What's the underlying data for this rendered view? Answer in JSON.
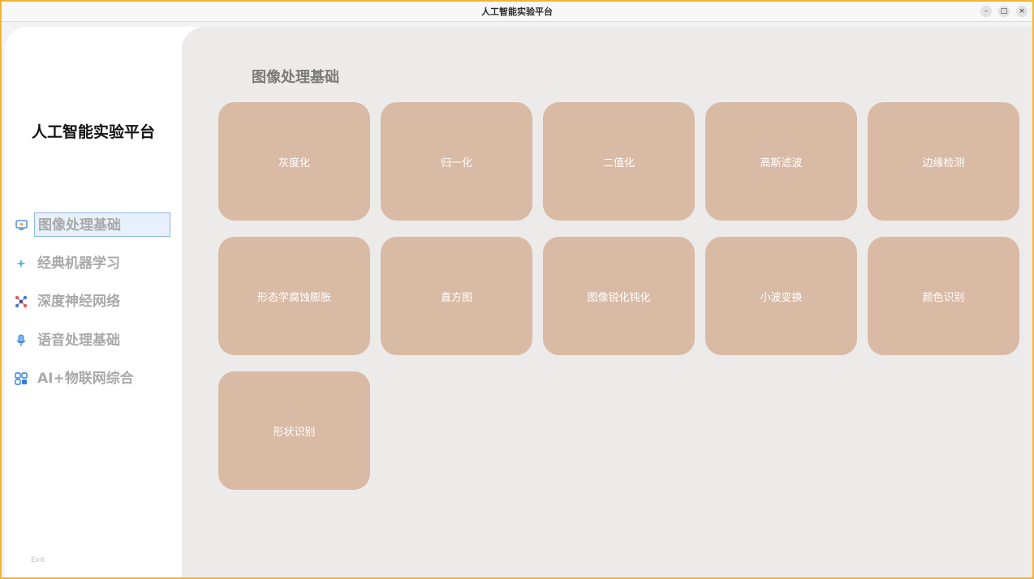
{
  "window": {
    "title": "人工智能实验平台",
    "controls": [
      "–",
      "□",
      "×"
    ]
  },
  "sidebar": {
    "app_title": "人工智能实验平台",
    "items": [
      {
        "label": "图像处理基础",
        "icon": "monitor-icon",
        "active": true
      },
      {
        "label": "经典机器学习",
        "icon": "sparkle-icon",
        "active": false
      },
      {
        "label": "深度神经网络",
        "icon": "network-icon",
        "active": false
      },
      {
        "label": "语音处理基础",
        "icon": "microphone-icon",
        "active": false
      },
      {
        "label": "AI+物联网综合",
        "icon": "apps-grid-icon",
        "active": false
      }
    ],
    "exit_label": "Exit"
  },
  "main": {
    "section_title": "图像处理基础",
    "cards": [
      "灰度化",
      "归一化",
      "二值化",
      "高斯滤波",
      "边缘检测",
      "形态学腐蚀膨胀",
      "直方图",
      "图像锐化钝化",
      "小波变换",
      "颜色识别",
      "形状识别"
    ]
  },
  "colors": {
    "card_bg": "#d9baa5",
    "main_bg": "#edeaea",
    "active_border": "#8fb7e3",
    "window_border": "#f3b531",
    "icon_blue": "#2f7fe0"
  }
}
